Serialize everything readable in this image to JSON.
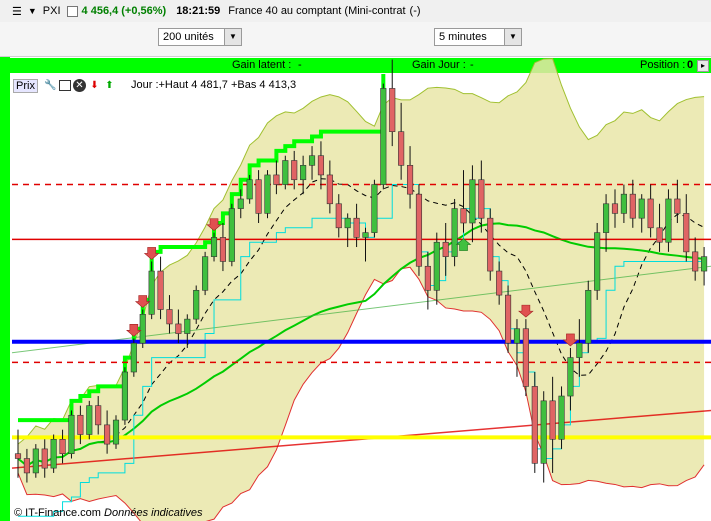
{
  "header": {
    "symbol": "PXI",
    "price": "4 456,4",
    "change": "(+0,56%)",
    "time": "18:21:59",
    "instrument": "France 40 au comptant (Mini-contrat",
    "instrument_suffix": "(-)"
  },
  "controls": {
    "quantity": "200 unités",
    "timeframe": "5 minutes"
  },
  "gain_bar": {
    "latent_label": "Gain latent :",
    "latent_value": "-",
    "jour_label": "Gain Jour :",
    "jour_value": "-",
    "position_label": "Position :",
    "position_value": "0"
  },
  "chart_toolbar": {
    "label": "Prix",
    "ohlc": "Jour :+Haut 4 481,7 +Bas 4 413,3"
  },
  "footer": {
    "copyright": "© IT-Finance.com",
    "note": "Données indicatives"
  },
  "colors": {
    "up_candle": "#3fbf3f",
    "down_candle": "#e06464",
    "band_fill": "#e9e6a8",
    "ma_green": "#00cc00",
    "ma_red": "#e00000",
    "support_blue": "#0000ff",
    "support_yellow": "#ffff00",
    "stop_green": "#00ff00"
  },
  "chart_data": {
    "type": "candlestick",
    "candles": [
      [
        4424,
        4429,
        4419,
        4423
      ],
      [
        4423,
        4425,
        4418,
        4420
      ],
      [
        4420,
        4426,
        4419,
        4425
      ],
      [
        4425,
        4427,
        4419,
        4421
      ],
      [
        4421,
        4428,
        4420,
        4427
      ],
      [
        4427,
        4429,
        4422,
        4424
      ],
      [
        4424,
        4433,
        4423,
        4432
      ],
      [
        4432,
        4434,
        4426,
        4428
      ],
      [
        4428,
        4435,
        4427,
        4434
      ],
      [
        4434,
        4436,
        4428,
        4430
      ],
      [
        4430,
        4433,
        4424,
        4426
      ],
      [
        4426,
        4432,
        4425,
        4431
      ],
      [
        4431,
        4442,
        4430,
        4441
      ],
      [
        4441,
        4448,
        4440,
        4447
      ],
      [
        4447,
        4454,
        4446,
        4453
      ],
      [
        4453,
        4464,
        4452,
        4462
      ],
      [
        4462,
        4465,
        4452,
        4454
      ],
      [
        4454,
        4457,
        4449,
        4451
      ],
      [
        4451,
        4454,
        4447,
        4449
      ],
      [
        4449,
        4453,
        4446,
        4452
      ],
      [
        4452,
        4459,
        4451,
        4458
      ],
      [
        4458,
        4466,
        4457,
        4465
      ],
      [
        4465,
        4470,
        4464,
        4469
      ],
      [
        4469,
        4472,
        4462,
        4464
      ],
      [
        4464,
        4476,
        4463,
        4475
      ],
      [
        4475,
        4479,
        4473,
        4477
      ],
      [
        4477,
        4482,
        4476,
        4481
      ],
      [
        4481,
        4483,
        4472,
        4474
      ],
      [
        4474,
        4483,
        4473,
        4482
      ],
      [
        4482,
        4485,
        4478,
        4480
      ],
      [
        4480,
        4486,
        4479,
        4485
      ],
      [
        4485,
        4487,
        4479,
        4481
      ],
      [
        4481,
        4486,
        4478,
        4484
      ],
      [
        4484,
        4488,
        4481,
        4486
      ],
      [
        4486,
        4489,
        4479,
        4482
      ],
      [
        4482,
        4485,
        4474,
        4476
      ],
      [
        4476,
        4478,
        4469,
        4471
      ],
      [
        4471,
        4474,
        4467,
        4473
      ],
      [
        4473,
        4476,
        4467,
        4469
      ],
      [
        4469,
        4471,
        4464,
        4470
      ],
      [
        4470,
        4481,
        4469,
        4480
      ],
      [
        4480,
        4501,
        4479,
        4500
      ],
      [
        4500,
        4506,
        4488,
        4491
      ],
      [
        4491,
        4497,
        4481,
        4484
      ],
      [
        4484,
        4488,
        4475,
        4478
      ],
      [
        4478,
        4480,
        4461,
        4463
      ],
      [
        4463,
        4466,
        4454,
        4458
      ],
      [
        4458,
        4470,
        4455,
        4468
      ],
      [
        4468,
        4472,
        4461,
        4465
      ],
      [
        4465,
        4477,
        4463,
        4475
      ],
      [
        4475,
        4483,
        4470,
        4472
      ],
      [
        4472,
        4484,
        4468,
        4481
      ],
      [
        4481,
        4485,
        4470,
        4473
      ],
      [
        4473,
        4475,
        4460,
        4462
      ],
      [
        4462,
        4464,
        4455,
        4457
      ],
      [
        4457,
        4459,
        4445,
        4447
      ],
      [
        4447,
        4452,
        4440,
        4450
      ],
      [
        4450,
        4452,
        4436,
        4438
      ],
      [
        4438,
        4441,
        4420,
        4422
      ],
      [
        4422,
        4437,
        4418,
        4435
      ],
      [
        4435,
        4440,
        4420,
        4427
      ],
      [
        4427,
        4438,
        4425,
        4436
      ],
      [
        4436,
        4446,
        4433,
        4444
      ],
      [
        4444,
        4452,
        4440,
        4447
      ],
      [
        4447,
        4460,
        4445,
        4458
      ],
      [
        4458,
        4472,
        4456,
        4470
      ],
      [
        4470,
        4478,
        4466,
        4476
      ],
      [
        4476,
        4479,
        4471,
        4474
      ],
      [
        4474,
        4480,
        4472,
        4478
      ],
      [
        4478,
        4481,
        4471,
        4473
      ],
      [
        4473,
        4478,
        4470,
        4477
      ],
      [
        4477,
        4480,
        4469,
        4471
      ],
      [
        4471,
        4476,
        4466,
        4468
      ],
      [
        4468,
        4479,
        4466,
        4477
      ],
      [
        4477,
        4481,
        4472,
        4474
      ],
      [
        4474,
        4478,
        4464,
        4466
      ],
      [
        4466,
        4469,
        4460,
        4462
      ],
      [
        4462,
        4467,
        4459,
        4465
      ]
    ],
    "ylim": [
      4410,
      4503
    ],
    "hlines": [
      {
        "name": "dashed-res-1",
        "y": 4480.0,
        "color": "#e00000",
        "style": "dashed"
      },
      {
        "name": "solid-red",
        "y": 4468.6,
        "color": "#e00000",
        "style": "solid"
      },
      {
        "name": "blue-support",
        "y": 4447.3,
        "color": "#0000ff",
        "style": "solid"
      },
      {
        "name": "dashed-sup",
        "y": 4443.0,
        "color": "#e00000",
        "style": "dashed"
      },
      {
        "name": "yellow-support",
        "y": 4427.4,
        "color": "#ffff00",
        "style": "solid"
      }
    ]
  }
}
